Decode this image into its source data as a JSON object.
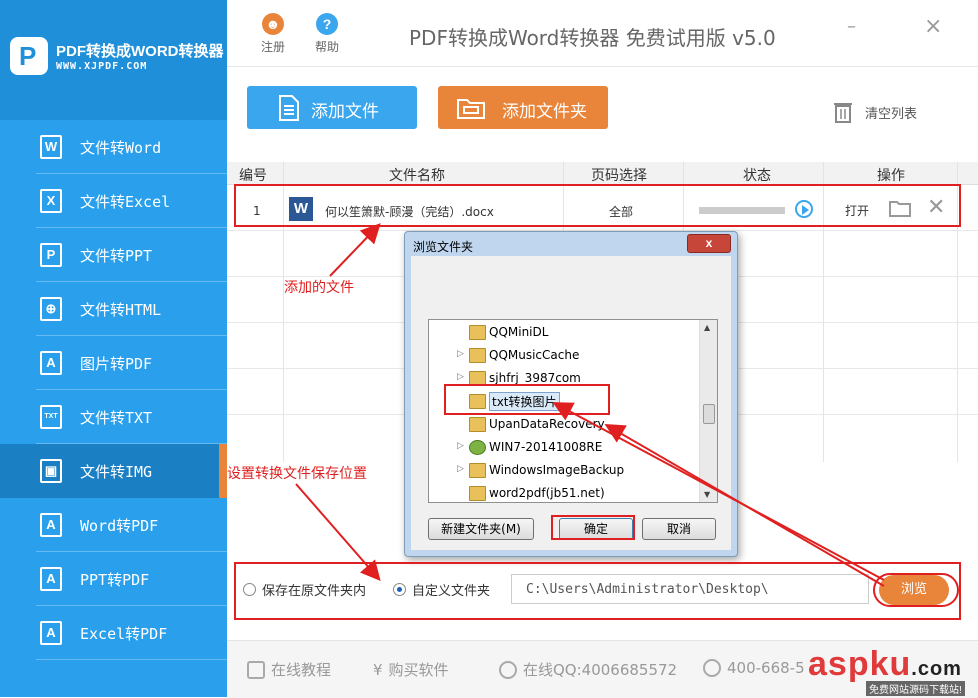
{
  "app": {
    "logo_text": "PDF转换成WORD转换器",
    "logo_url": "WWW.XJPDF.COM",
    "window_title": "PDF转换成Word转换器 免费试用版 v5.0",
    "register_label": "注册",
    "help_label": "帮助",
    "minimize_glyph": "–",
    "close_glyph": "×"
  },
  "colors": {
    "sidebar": "#2aa0ec",
    "sidebar_active": "#1b7fc4",
    "accent_orange": "#e8853a",
    "accent_blue": "#3aa6ee",
    "annotation_red": "#e02020"
  },
  "sidebar": {
    "items": [
      {
        "label": "文件转Word",
        "icon": "word-icon",
        "glyph": "W"
      },
      {
        "label": "文件转Excel",
        "icon": "excel-icon",
        "glyph": "X"
      },
      {
        "label": "文件转PPT",
        "icon": "ppt-icon",
        "glyph": "P"
      },
      {
        "label": "文件转HTML",
        "icon": "globe-icon",
        "glyph": "⊕"
      },
      {
        "label": "图片转PDF",
        "icon": "pdf-icon",
        "glyph": "A"
      },
      {
        "label": "文件转TXT",
        "icon": "txt-icon",
        "glyph": "TXT"
      },
      {
        "label": "文件转IMG",
        "icon": "image-icon",
        "glyph": "▣",
        "active": true
      },
      {
        "label": "Word转PDF",
        "icon": "pdf-icon",
        "glyph": "A"
      },
      {
        "label": "PPT转PDF",
        "icon": "pdf-icon",
        "glyph": "A"
      },
      {
        "label": "Excel转PDF",
        "icon": "pdf-icon",
        "glyph": "A"
      }
    ]
  },
  "toolbar": {
    "add_file_label": "添加文件",
    "add_folder_label": "添加文件夹",
    "clear_list_label": "清空列表"
  },
  "table": {
    "headers": [
      "编号",
      "文件名称",
      "页码选择",
      "状态",
      "操作"
    ],
    "row": {
      "index": "1",
      "file_name": "何以笙箫默-顾漫（完结）.docx",
      "page_select": "全部",
      "progress": 0,
      "open_label": "打开"
    }
  },
  "dialog": {
    "title": "浏览文件夹",
    "close_glyph": "x",
    "folders": [
      {
        "name": "QQMiniDL",
        "expandable": false,
        "icon": "folder-icon"
      },
      {
        "name": "QQMusicCache",
        "expandable": true,
        "icon": "folder-icon"
      },
      {
        "name": "sjhfrj_3987com",
        "expandable": true,
        "icon": "folder-icon"
      },
      {
        "name": "txt转换图片",
        "expandable": false,
        "icon": "folder-icon",
        "selected": true
      },
      {
        "name": "UpanDataRecovery",
        "expandable": false,
        "icon": "folder-icon"
      },
      {
        "name": "WIN7-20141008RE",
        "expandable": true,
        "icon": "network-icon"
      },
      {
        "name": "WindowsImageBackup",
        "expandable": true,
        "icon": "folder-icon"
      },
      {
        "name": "word2pdf(jb51.net)",
        "expandable": false,
        "icon": "folder-icon"
      }
    ],
    "new_folder_label": "新建文件夹(M)",
    "ok_label": "确定",
    "cancel_label": "取消"
  },
  "save": {
    "option_original_label": "保存在原文件夹内",
    "option_custom_label": "自定义文件夹",
    "selected_option": "custom",
    "path_value": "C:\\Users\\Administrator\\Desktop\\",
    "browse_label": "浏览"
  },
  "footer": {
    "tutorial_label": "在线教程",
    "buy_label": "购买软件",
    "qq_label": "在线QQ:4006685572",
    "phone_label": "400-668-5"
  },
  "annotations": {
    "added_file": "添加的文件",
    "set_location": "设置转换文件保存位置"
  },
  "watermark": {
    "brand": "aspku",
    "brand_suffix": ".com",
    "tagline": "免费网站源码下载站!"
  }
}
